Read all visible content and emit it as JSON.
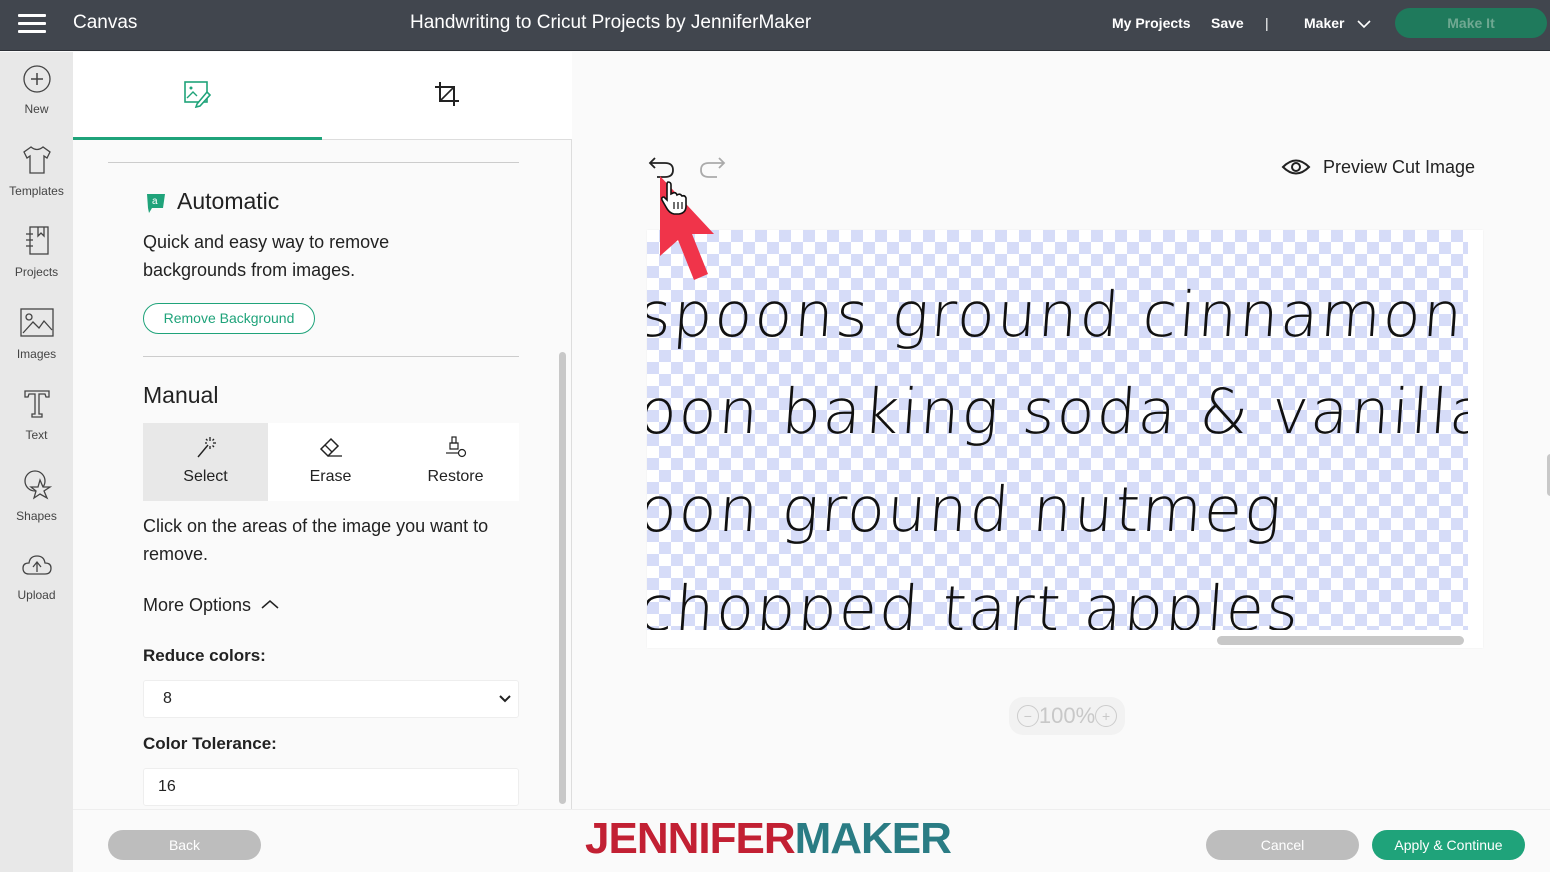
{
  "topbar": {
    "app_name": "Canvas",
    "doc_title": "Handwriting to Cricut Projects by JenniferMaker",
    "my_projects": "My Projects",
    "save": "Save",
    "separator": "|",
    "machine": "Maker",
    "make_it": "Make It"
  },
  "leftnav": {
    "items": [
      {
        "label": "New",
        "icon": "plus-circle-icon"
      },
      {
        "label": "Templates",
        "icon": "tshirt-icon"
      },
      {
        "label": "Projects",
        "icon": "notebook-icon"
      },
      {
        "label": "Images",
        "icon": "image-icon"
      },
      {
        "label": "Text",
        "icon": "text-t-icon"
      },
      {
        "label": "Shapes",
        "icon": "shapes-icon"
      },
      {
        "label": "Upload",
        "icon": "cloud-upload-icon"
      }
    ]
  },
  "panel": {
    "tabs": [
      {
        "name": "background-remover",
        "icon": "image-edit-icon",
        "active": true
      },
      {
        "name": "crop",
        "icon": "crop-icon",
        "active": false
      }
    ],
    "automatic": {
      "title": "Automatic",
      "description_line1": "Quick and easy way to remove",
      "description_line2": "backgrounds from images.",
      "button": "Remove Background"
    },
    "manual": {
      "title": "Manual",
      "tools": [
        {
          "label": "Select",
          "icon": "magic-wand-icon",
          "active": true
        },
        {
          "label": "Erase",
          "icon": "eraser-icon",
          "active": false
        },
        {
          "label": "Restore",
          "icon": "restore-brush-icon",
          "active": false
        }
      ],
      "instruction_line1": "Click on the areas of the image you want to",
      "instruction_line2": "remove.",
      "more_options": "More Options"
    },
    "reduce_colors": {
      "label": "Reduce colors:",
      "value": "8"
    },
    "color_tolerance": {
      "label": "Color Tolerance:",
      "value": "16"
    }
  },
  "canvas": {
    "preview_label": "Preview Cut Image",
    "handwriting_lines": [
      "spoons ground cinnamon",
      "oon baking soda & vanilla",
      "oon ground nutmeg",
      "chopped tart apples"
    ],
    "zoom_level": "100%"
  },
  "footer": {
    "back": "Back",
    "brand_part1": "JENNIFER",
    "brand_part2": "MAKER",
    "cancel": "Cancel",
    "apply": "Apply & Continue"
  },
  "colors": {
    "accent_green": "#1fa37a",
    "topbar_bg": "#41464e",
    "brand_red": "#c22033",
    "brand_teal": "#2a7c84",
    "annotation_arrow": "#f0344a"
  }
}
